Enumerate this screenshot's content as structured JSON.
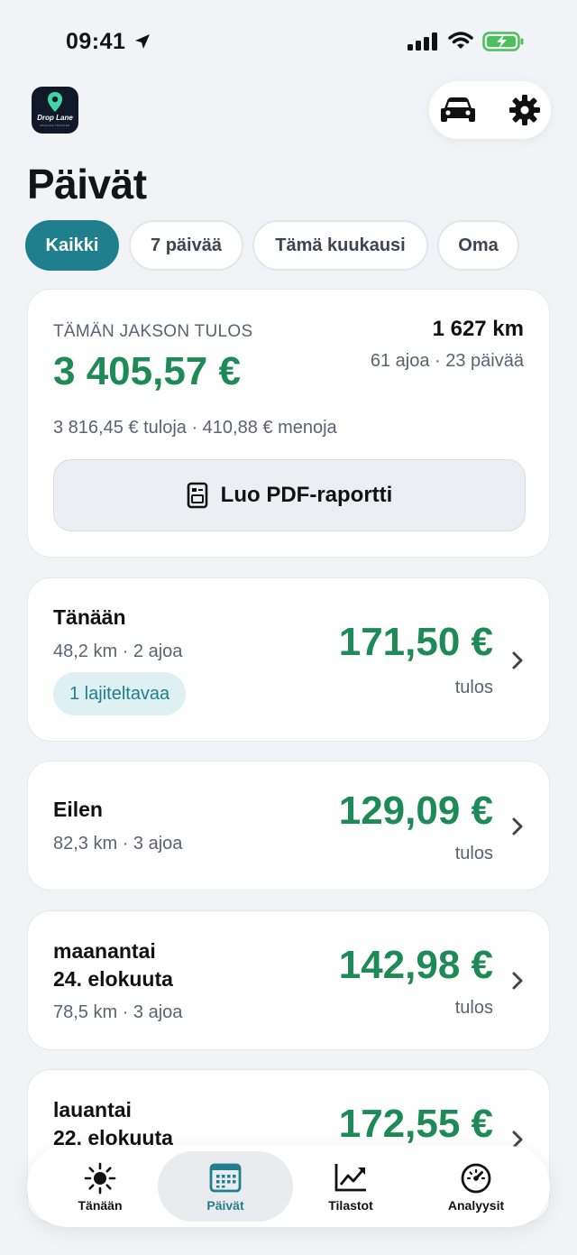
{
  "status_bar": {
    "time": "09:41"
  },
  "app": {
    "logo_text": "Drop Lane",
    "logo_sub": "MILEAGE TRACKER"
  },
  "page": {
    "title": "Päivät"
  },
  "filters": [
    {
      "label": "Kaikki",
      "active": true
    },
    {
      "label": "7 päivää",
      "active": false
    },
    {
      "label": "Tämä kuukausi",
      "active": false
    },
    {
      "label": "Oma",
      "active": false
    }
  ],
  "summary": {
    "label": "TÄMÄN JAKSON TULOS",
    "value": "3 405,57 €",
    "km": "1 627 km",
    "meta": "61 ajoa · 23 päivää",
    "breakdown": "3 816,45 € tuloja · 410,88 € menoja",
    "pdf_button": "Luo PDF-raportti"
  },
  "days": [
    {
      "title": "Tänään",
      "meta": "48,2 km · 2 ajoa",
      "amount": "171,50 €",
      "caption": "tulos",
      "badge": "1 lajiteltavaa"
    },
    {
      "title": "Eilen",
      "meta": "82,3 km · 3 ajoa",
      "amount": "129,09 €",
      "caption": "tulos"
    },
    {
      "title_line1": "maanantai",
      "title_line2": "24. elokuuta",
      "meta": "78,5 km · 3 ajoa",
      "amount": "142,98 €",
      "caption": "tulos"
    },
    {
      "title_line1": "lauantai",
      "title_line2": "22. elokuuta",
      "amount": "172,55 €"
    }
  ],
  "tabs": [
    {
      "label": "Tänään",
      "icon": "sun-icon",
      "active": false
    },
    {
      "label": "Päivät",
      "icon": "calendar-icon",
      "active": true
    },
    {
      "label": "Tilastot",
      "icon": "chart-icon",
      "active": false
    },
    {
      "label": "Analyysit",
      "icon": "gauge-icon",
      "active": false
    }
  ],
  "colors": {
    "accent": "#1f7f8c",
    "profit": "#1e8a55",
    "background": "#f2f3f7"
  }
}
